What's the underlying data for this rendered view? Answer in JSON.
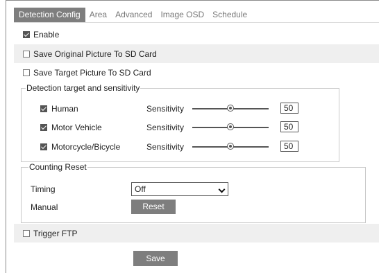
{
  "tabs": [
    {
      "label": "Detection Config",
      "active": true
    },
    {
      "label": "Area",
      "active": false
    },
    {
      "label": "Advanced",
      "active": false
    },
    {
      "label": "Image OSD",
      "active": false
    },
    {
      "label": "Schedule",
      "active": false
    }
  ],
  "enable": {
    "label": "Enable",
    "checked": true
  },
  "save_original": {
    "label": "Save Original Picture To SD Card",
    "checked": false
  },
  "save_target": {
    "label": "Save Target Picture To SD Card",
    "checked": false
  },
  "detection": {
    "legend": "Detection target and sensitivity",
    "sensitivity_label": "Sensitivity",
    "targets": [
      {
        "label": "Human",
        "checked": true,
        "sensitivity": "50"
      },
      {
        "label": "Motor Vehicle",
        "checked": true,
        "sensitivity": "50"
      },
      {
        "label": "Motorcycle/Bicycle",
        "checked": true,
        "sensitivity": "50"
      }
    ]
  },
  "counting_reset": {
    "legend": "Counting Reset",
    "timing_label": "Timing",
    "timing_value": "Off",
    "manual_label": "Manual",
    "reset_button": "Reset"
  },
  "trigger_ftp": {
    "label": "Trigger FTP",
    "checked": false
  },
  "save_button": "Save",
  "colors": {
    "button_bg": "#7e7e7e",
    "shaded_row": "#efefef",
    "active_tab": "#7e7e7e"
  }
}
